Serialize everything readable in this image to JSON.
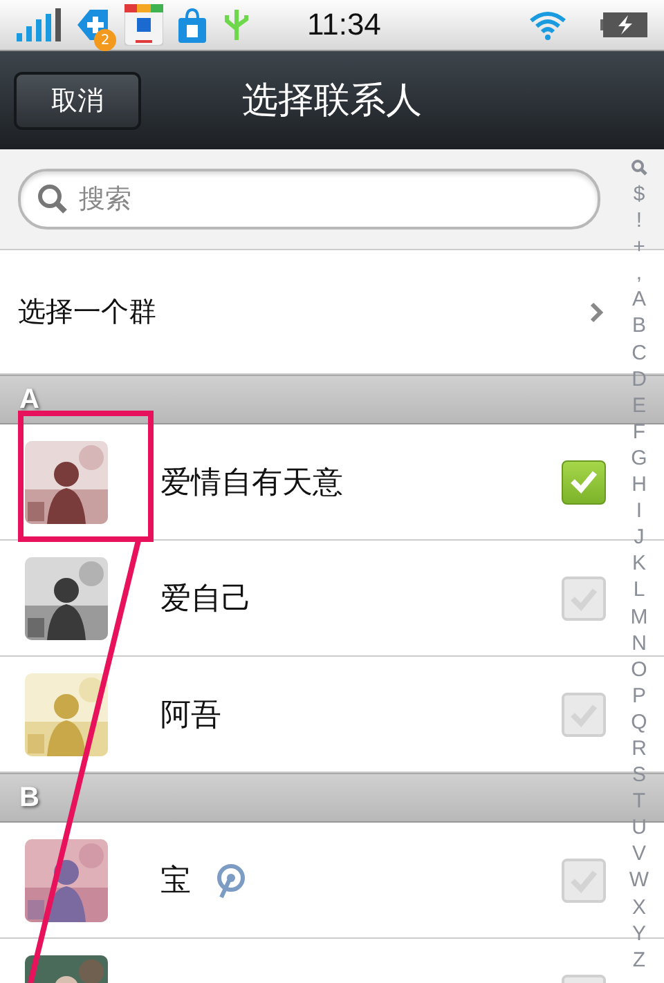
{
  "status_bar": {
    "notification_badge": "2",
    "time": "11:34"
  },
  "nav": {
    "cancel": "取消",
    "title": "选择联系人"
  },
  "search": {
    "placeholder": "搜索"
  },
  "group_row": {
    "label": "选择一个群"
  },
  "sections": [
    {
      "letter": "A",
      "contacts": [
        {
          "name": "爱情自有天意",
          "checked": true,
          "weibo": false
        },
        {
          "name": "爱自己",
          "checked": false,
          "weibo": false
        },
        {
          "name": "阿吾",
          "checked": false,
          "weibo": false
        }
      ]
    },
    {
      "letter": "B",
      "contacts": [
        {
          "name": "宝",
          "checked": false,
          "weibo": true
        },
        {
          "checked": false,
          "weibo": false
        }
      ]
    }
  ],
  "index": [
    "$",
    "!",
    "+",
    ",",
    "A",
    "B",
    "C",
    "D",
    "E",
    "F",
    "G",
    "H",
    "I",
    "J",
    "K",
    "L",
    "M",
    "N",
    "O",
    "P",
    "Q",
    "R",
    "S",
    "T",
    "U",
    "V",
    "W",
    "X",
    "Y",
    "Z"
  ]
}
